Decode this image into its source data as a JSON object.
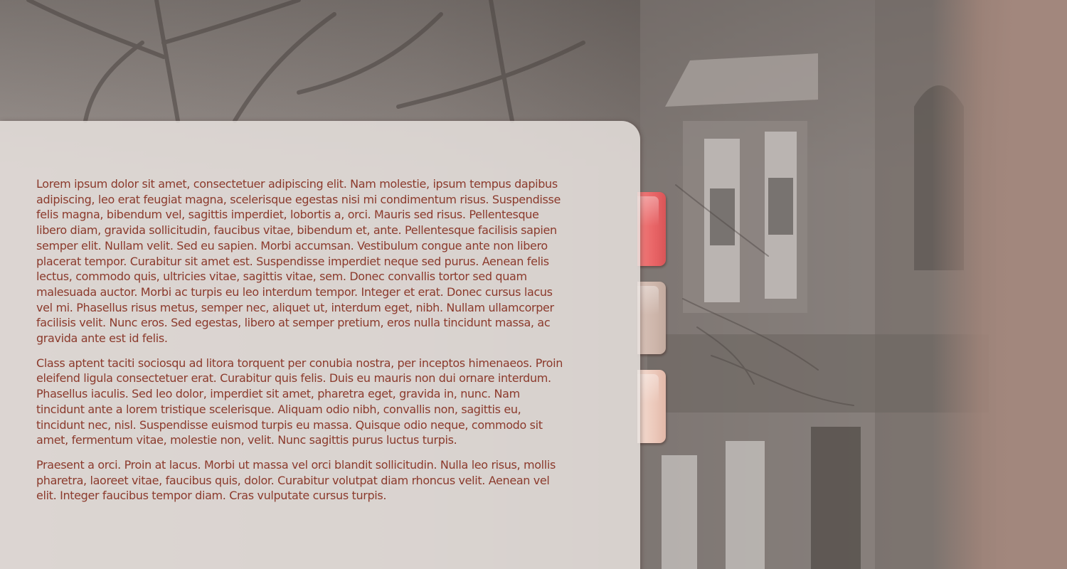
{
  "colors": {
    "text": "#8b3a2c",
    "panel": "#e8e2df",
    "tab_active": "#e86466",
    "tab_2": "#ceb6ab",
    "tab_3": "#ecc9bb",
    "sidebar": "#a2877d"
  },
  "tabs": [
    {
      "label": "",
      "state": "active"
    },
    {
      "label": "",
      "state": "inactive"
    },
    {
      "label": "",
      "state": "inactive"
    }
  ],
  "content": {
    "paragraphs": [
      "Lorem ipsum dolor sit amet, consectetuer adipiscing elit. Nam molestie, ipsum tempus dapibus adipiscing, leo erat feugiat magna, scelerisque egestas nisi mi condimentum risus. Suspendisse felis magna, bibendum vel, sagittis imperdiet, lobortis a, orci. Mauris sed risus. Pellentesque libero diam, gravida sollicitudin, faucibus vitae, bibendum et, ante. Pellentesque facilisis sapien semper elit. Nullam velit. Sed eu sapien. Morbi accumsan. Vestibulum congue ante non libero placerat tempor. Curabitur sit amet est. Suspendisse imperdiet neque sed purus. Aenean felis lectus, commodo quis, ultricies vitae, sagittis vitae, sem. Donec convallis tortor sed quam malesuada auctor. Morbi ac turpis eu leo interdum tempor. Integer et erat. Donec cursus lacus vel mi. Phasellus risus metus, semper nec, aliquet ut, interdum eget, nibh. Nullam ullamcorper facilisis velit. Nunc eros. Sed egestas, libero at semper pretium, eros nulla tincidunt massa, ac gravida ante est id felis.",
      "Class aptent taciti sociosqu ad litora torquent per conubia nostra, per inceptos himenaeos. Proin eleifend ligula consectetuer erat. Curabitur quis felis. Duis eu mauris non dui ornare interdum. Phasellus iaculis. Sed leo dolor, imperdiet sit amet, pharetra eget, gravida in, nunc. Nam tincidunt ante a lorem tristique scelerisque. Aliquam odio nibh, convallis non, sagittis eu, tincidunt nec, nisl. Suspendisse euismod turpis eu massa. Quisque odio neque, commodo sit amet, fermentum vitae, molestie non, velit. Nunc sagittis purus luctus turpis.",
      "Praesent a orci. Proin at lacus. Morbi ut massa vel orci blandit sollicitudin. Nulla leo risus, mollis pharetra, laoreet vitae, faucibus quis, dolor. Curabitur volutpat diam rhoncus velit. Aenean vel elit. Integer faucibus tempor diam. Cras vulputate cursus turpis."
    ]
  }
}
